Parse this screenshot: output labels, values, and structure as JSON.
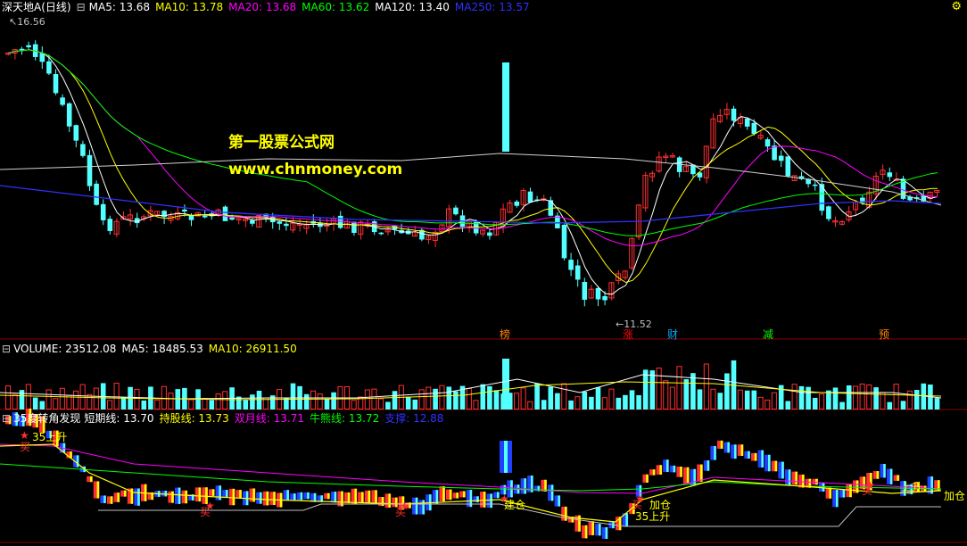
{
  "main_panel": {
    "stock_name": "深天地A",
    "period": "(日线)",
    "ma": [
      {
        "label": "MA5: 13.68",
        "color": "#ffffff"
      },
      {
        "label": "MA10: 13.78",
        "color": "#ffff00"
      },
      {
        "label": "MA20: 13.68",
        "color": "#ff00ff"
      },
      {
        "label": "MA60: 13.62",
        "color": "#00ff00"
      },
      {
        "label": "MA120: 13.40",
        "color": "#ffffff"
      },
      {
        "label": "MA250: 13.57",
        "color": "#3030ff"
      }
    ],
    "high_marker": "16.56",
    "low_marker": "11.52",
    "watermark_title": "第一股票公式网",
    "watermark_url": "www.chnmoney.com",
    "events": [
      {
        "label": "榜",
        "color": "#ff8000"
      },
      {
        "label": "涨",
        "color": "#ff0000"
      },
      {
        "label": "财",
        "color": "#00aaff"
      },
      {
        "label": "减",
        "color": "#00ff00"
      },
      {
        "label": "预",
        "color": "#ff8000"
      }
    ]
  },
  "volume_panel": {
    "label": "VOLUME: 23512.08",
    "ma5": "MA5: 18485.53",
    "ma10": "MA10: 26911.50"
  },
  "indicator_panel": {
    "name": "35度转角发现",
    "short_line": "短期线: 13.70",
    "hold_line": "持股线: 13.73",
    "double_month_line": "双月线: 13.71",
    "bull_line": "牛熊线: 13.72",
    "support": "支撑: 12.88",
    "signals": [
      {
        "label": "35上升",
        "color": "#ffff00"
      },
      {
        "label": "买",
        "color": "#ff3030"
      },
      {
        "label": "买",
        "color": "#ff3030"
      },
      {
        "label": "买",
        "color": "#ff3030"
      },
      {
        "label": "建仓",
        "color": "#ffff00"
      },
      {
        "label": "加仓",
        "color": "#ffff00"
      },
      {
        "label": "35上升",
        "color": "#ffff00"
      },
      {
        "label": "买",
        "color": "#ff3030"
      },
      {
        "label": "买",
        "color": "#ff3030"
      },
      {
        "label": "上升",
        "color": "#ffff00"
      },
      {
        "label": "加仓",
        "color": "#ffff00"
      }
    ]
  },
  "colors": {
    "up": "#ff3030",
    "down": "#54ffff",
    "grid": "#8b0000"
  }
}
